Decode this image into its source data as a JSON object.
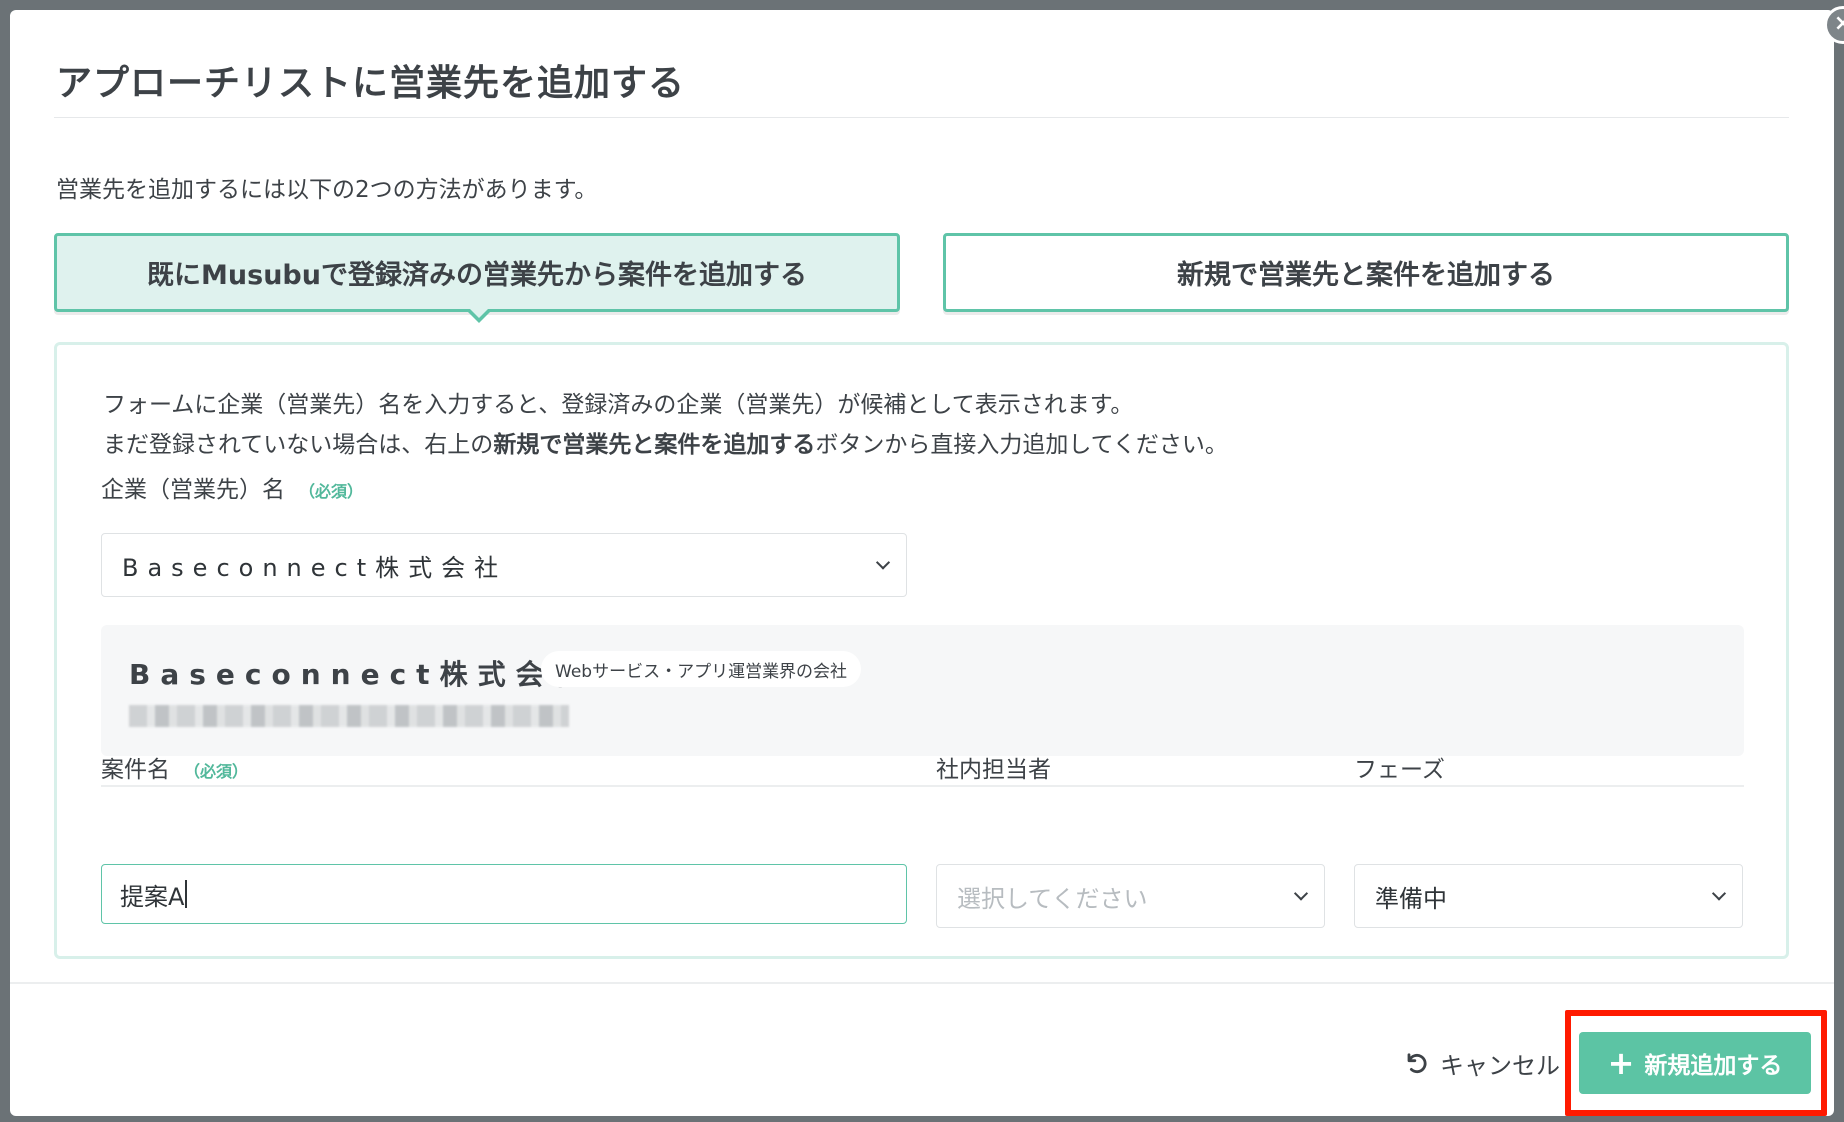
{
  "modal": {
    "title": "アプローチリストに営業先を追加する",
    "intro": "営業先を追加するには以下の2つの方法があります。",
    "close_icon": "×"
  },
  "tabs": [
    {
      "label": "既にMusubuで登録済みの営業先から案件を追加する",
      "active": true
    },
    {
      "label": "新規で営業先と案件を追加する",
      "active": false
    }
  ],
  "help": {
    "line1": "フォームに企業（営業先）名を入力すると、登録済みの企業（営業先）が候補として表示されます。",
    "line2_prefix": "まだ登録されていない場合は、右上の",
    "line2_bold": "新規で営業先と案件を追加する",
    "line2_suffix": "ボタンから直接入力追加してください。"
  },
  "company_field": {
    "label": "企業（営業先）名",
    "required": "（必須）",
    "value": "Baseconnect株式会社"
  },
  "company_card": {
    "name": "Baseconnect株式会社",
    "badge": "Webサービス・アプリ運営業界の会社"
  },
  "deal_field": {
    "label": "案件名",
    "required": "（必須）",
    "value": "提案A"
  },
  "staff_field": {
    "label": "社内担当者",
    "placeholder": "選択してください"
  },
  "phase_field": {
    "label": "フェーズ",
    "value": "準備中"
  },
  "footer": {
    "cancel_label": "キャンセル",
    "add_label": "新規追加する",
    "add_icon": "+"
  },
  "colors": {
    "accent": "#5cc4a4",
    "tab_active_bg": "#dff2ee",
    "highlight": "#ff1a00"
  },
  "icons": [
    "close-icon",
    "chevron-down-icon",
    "undo-icon",
    "plus-icon"
  ]
}
